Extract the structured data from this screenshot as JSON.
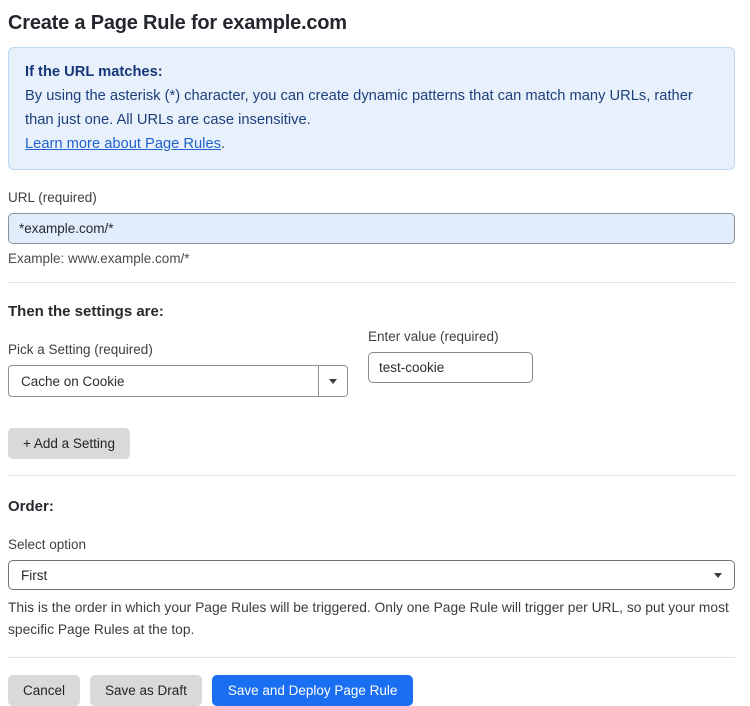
{
  "header": {
    "title": "Create a Page Rule for example.com"
  },
  "infobox": {
    "heading": "If the URL matches:",
    "body": "By using the asterisk (*) character, you can create dynamic patterns that can match many URLs, rather than just one. All URLs are case insensitive.",
    "link_text": "Learn more about Page Rules",
    "link_suffix": "."
  },
  "url_field": {
    "label": "URL (required)",
    "value": "*example.com/*",
    "example": "Example: www.example.com/*"
  },
  "settings": {
    "heading": "Then the settings are:",
    "pick_label": "Pick a Setting (required)",
    "pick_value": "Cache on Cookie",
    "value_label": "Enter value (required)",
    "value_value": "test-cookie",
    "add_button": "+ Add a Setting"
  },
  "order": {
    "heading": "Order:",
    "select_label": "Select option",
    "select_value": "First",
    "help_text": "This is the order in which your Page Rules will be triggered. Only one Page Rule will trigger per URL, so put your most specific Page Rules at the top."
  },
  "actions": {
    "cancel": "Cancel",
    "save_draft": "Save as Draft",
    "save_deploy": "Save and Deploy Page Rule"
  },
  "colors": {
    "accent_blue": "#1a6ef2",
    "infobox_bg": "#e8f1fb",
    "infobox_border": "#bcd7f3",
    "infobox_text": "#1d3f7c",
    "link_blue": "#2262cc",
    "url_input_bg": "#e2edfc",
    "gray_button_bg": "#d9d9d9"
  }
}
